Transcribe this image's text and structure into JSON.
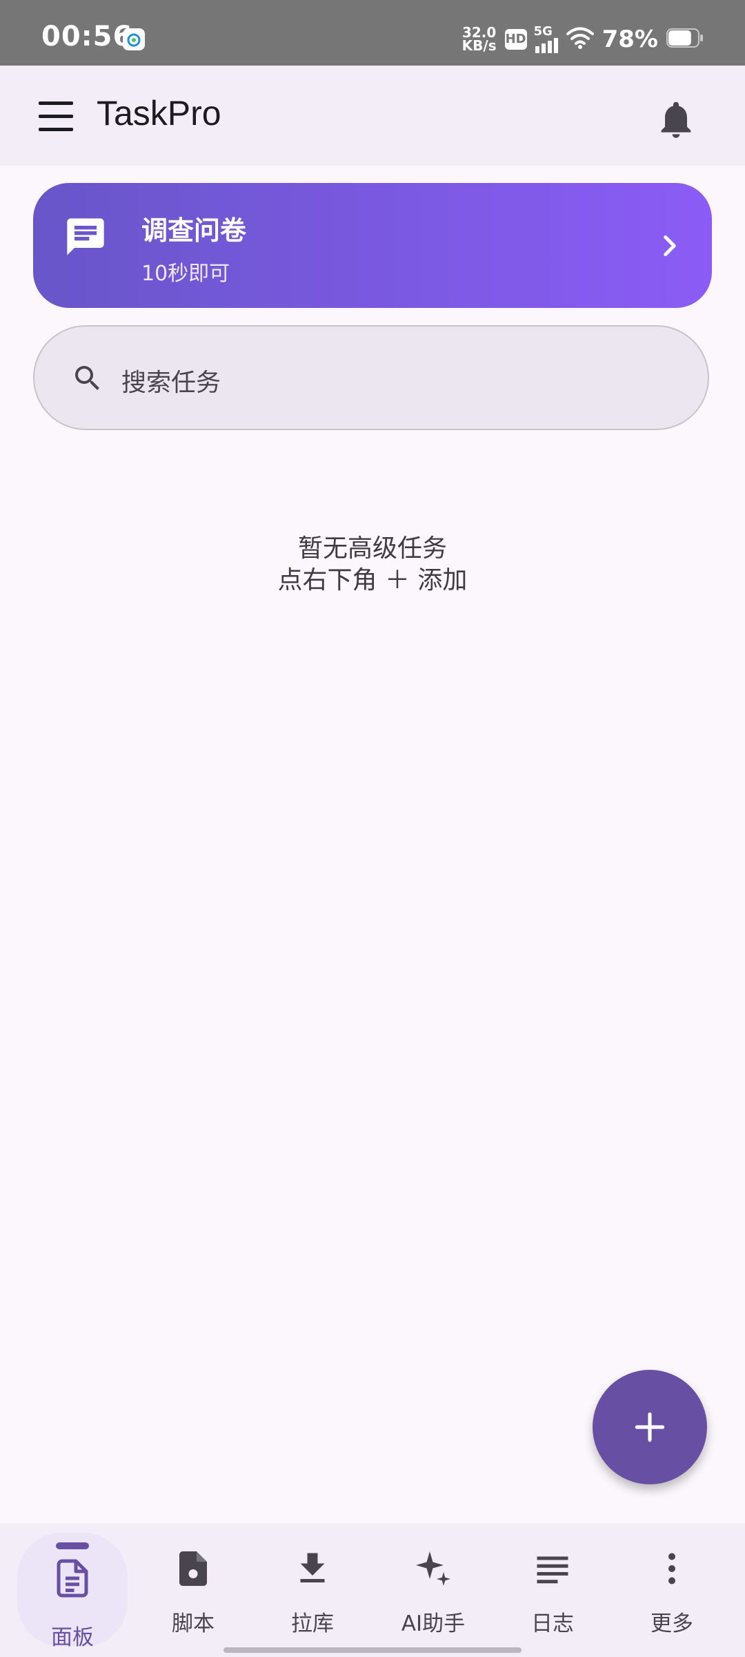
{
  "status_bar": {
    "time": "00:56",
    "net_speed_value": "32.0",
    "net_speed_unit": "KB/s",
    "hd_badge": "HD",
    "network": "5G",
    "battery_percent": "78%",
    "battery_level": 0.78
  },
  "app_bar": {
    "title": "TaskPro",
    "menu_icon": "menu-icon",
    "notifications_icon": "bell-icon"
  },
  "survey_banner": {
    "icon": "message-icon",
    "title": "调查问卷",
    "subtitle": "10秒即可",
    "chevron": "chevron-right-icon"
  },
  "search": {
    "icon": "search-icon",
    "placeholder": "搜索任务"
  },
  "empty_state": {
    "line1": "暂无高级任务",
    "line2": "点右下角 ＋ 添加"
  },
  "fab": {
    "icon": "plus-icon"
  },
  "bottom_nav": {
    "items": [
      {
        "label": "面板",
        "icon": "document-icon",
        "active": true
      },
      {
        "label": "脚本",
        "icon": "script-file-icon",
        "active": false
      },
      {
        "label": "拉库",
        "icon": "download-icon",
        "active": false
      },
      {
        "label": "AI助手",
        "icon": "sparkle-icon",
        "active": false
      },
      {
        "label": "日志",
        "icon": "list-lines-icon",
        "active": false
      },
      {
        "label": "更多",
        "icon": "more-vert-icon",
        "active": false
      }
    ]
  },
  "colors": {
    "primary": "#6750a4",
    "banner_start": "#6856c9",
    "banner_end": "#8b5cf6",
    "background": "#fcf7fc",
    "surface": "#f3edf7"
  }
}
